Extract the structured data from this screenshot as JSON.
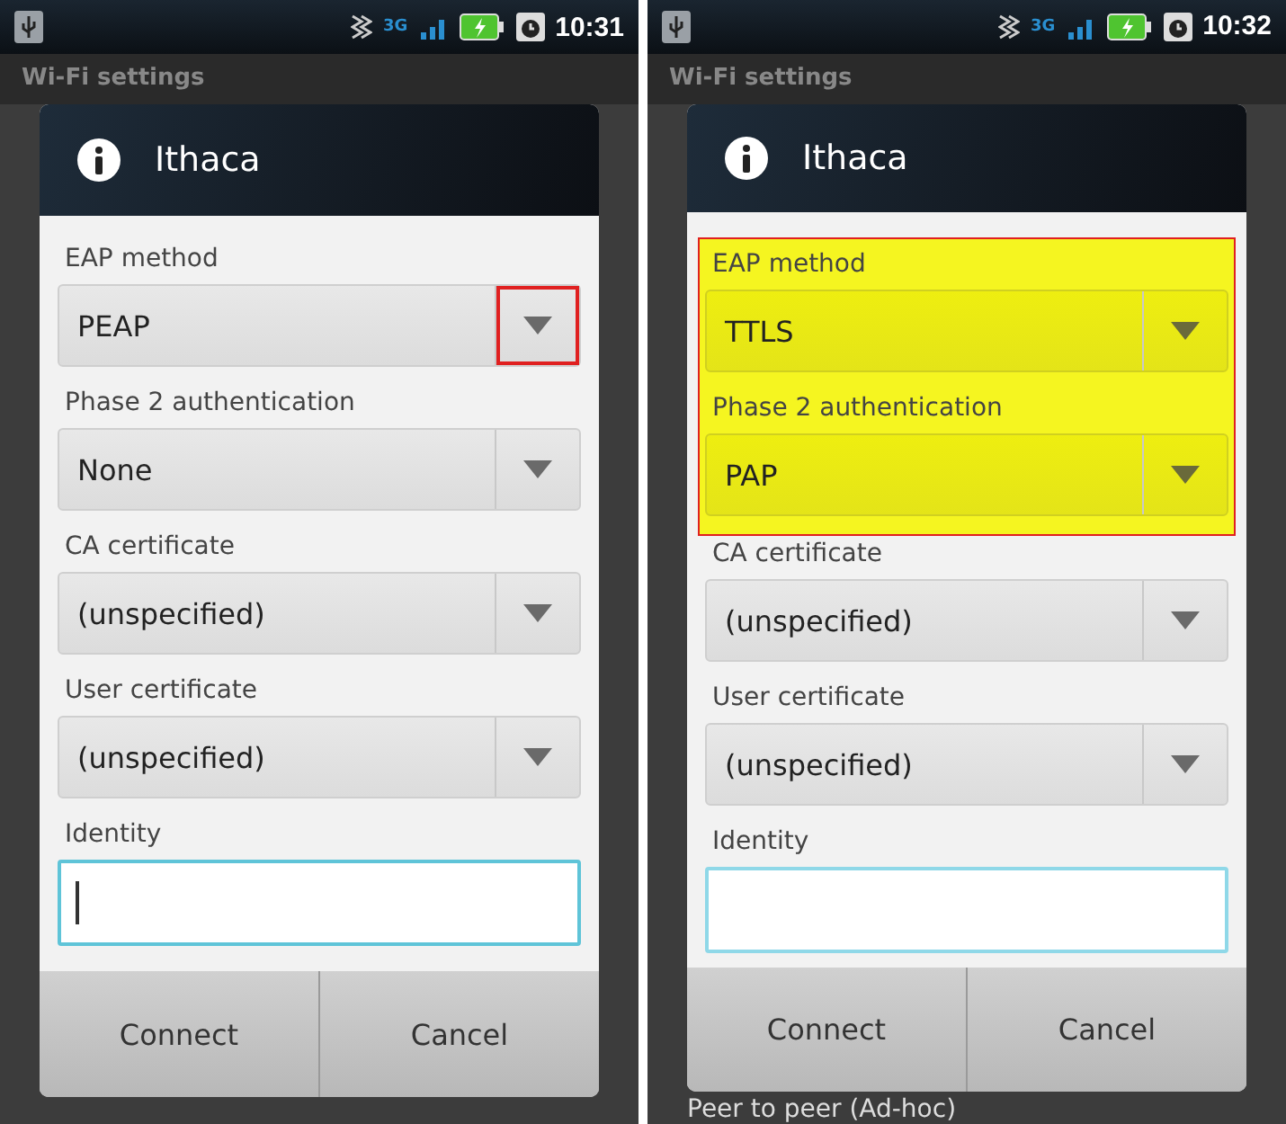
{
  "screens": [
    {
      "status_bar": {
        "network": "3G",
        "time": "10:31"
      },
      "app_title": "Wi-Fi settings",
      "dialog": {
        "title": "Ithaca",
        "fields": [
          {
            "kind": "dropdown",
            "label": "EAP method",
            "value": "PEAP",
            "arrow_marked": true,
            "highlighted": false
          },
          {
            "kind": "dropdown",
            "label": "Phase 2 authentication",
            "value": "None",
            "arrow_marked": false,
            "highlighted": false
          },
          {
            "kind": "dropdown",
            "label": "CA certificate",
            "value": "(unspecified)",
            "arrow_marked": false,
            "highlighted": false
          },
          {
            "kind": "dropdown",
            "label": "User certificate",
            "value": "(unspecified)",
            "arrow_marked": false,
            "highlighted": false
          },
          {
            "kind": "text",
            "label": "Identity",
            "focused": true
          }
        ],
        "buttons": [
          "Connect",
          "Cancel"
        ]
      }
    },
    {
      "status_bar": {
        "network": "3G",
        "time": "10:32"
      },
      "app_title": "Wi-Fi settings",
      "dialog": {
        "title": "Ithaca",
        "fields": [
          {
            "kind": "dropdown",
            "label": "EAP method",
            "value": "TTLS",
            "arrow_marked": false,
            "highlighted": true
          },
          {
            "kind": "dropdown",
            "label": "Phase 2 authentication",
            "value": "PAP",
            "arrow_marked": false,
            "highlighted": true
          },
          {
            "kind": "dropdown",
            "label": "CA certificate",
            "value": "(unspecified)",
            "arrow_marked": false,
            "highlighted": false
          },
          {
            "kind": "dropdown",
            "label": "User certificate",
            "value": "(unspecified)",
            "arrow_marked": false,
            "highlighted": false
          },
          {
            "kind": "text",
            "label": "Identity",
            "focused": false
          }
        ],
        "buttons": [
          "Connect",
          "Cancel"
        ]
      },
      "background_text": "Peer to peer (Ad-hoc)"
    }
  ]
}
